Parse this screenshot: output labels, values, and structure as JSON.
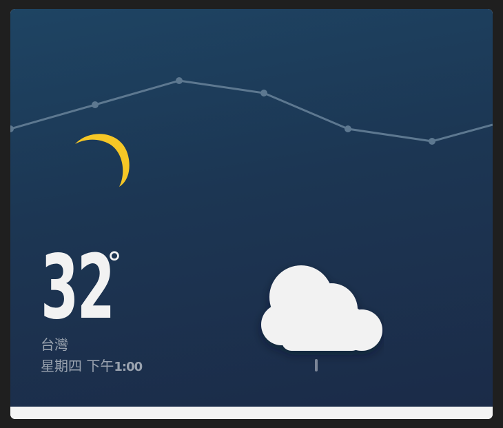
{
  "weather": {
    "temperature": "32",
    "unit": "°",
    "location": "台灣",
    "day": "星期四",
    "period": "下午",
    "time": "1:00",
    "condition_icon": "cloud-rain-icon",
    "night_icon": "crescent-moon-icon"
  },
  "colors": {
    "background_top": "#1e4463",
    "background_bottom": "#1b2b48",
    "moon": "#f6c726",
    "cloud": "#f2f2f2",
    "text_primary": "#f2f2f2",
    "text_secondary": "#9aa3af"
  }
}
